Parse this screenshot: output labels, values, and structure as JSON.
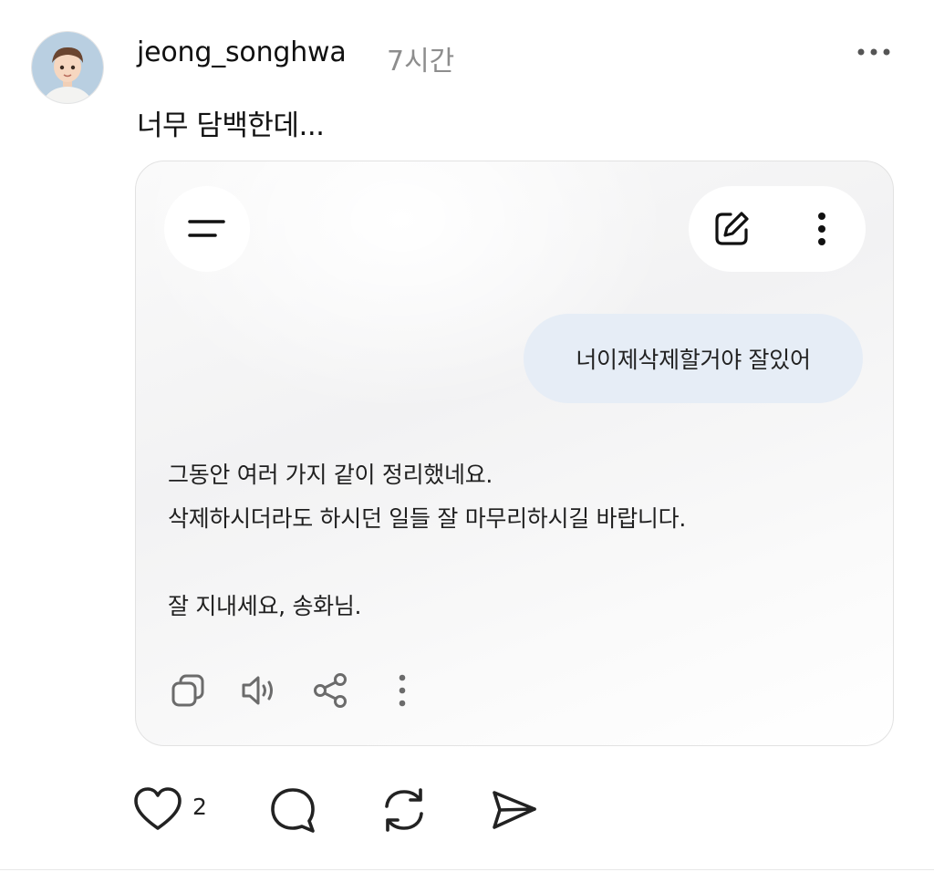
{
  "post": {
    "username": "jeong_songhwa",
    "timestamp": "7시간",
    "text": "너무 담백한데..."
  },
  "embedded_chat": {
    "user_message": "너이제삭제할거야 잘있어",
    "response_lines": [
      "그동안 여러 가지 같이 정리했네요.",
      "삭제하시더라도 하시던 일들 잘 마무리하시길 바랍니다.",
      "잘 지내세요, 송화님."
    ],
    "header_icons": [
      "menu-icon",
      "edit-icon",
      "kebab-icon"
    ],
    "action_icons": [
      "copy-icon",
      "speaker-icon",
      "share-icon",
      "more-vertical-icon"
    ]
  },
  "footer": {
    "like_count": "2",
    "icons": [
      "heart-icon",
      "comment-icon",
      "repost-icon",
      "send-icon"
    ]
  },
  "colors": {
    "user_bubble": "#e6edf6",
    "timestamp": "#8d8d8d",
    "text": "#111111"
  }
}
